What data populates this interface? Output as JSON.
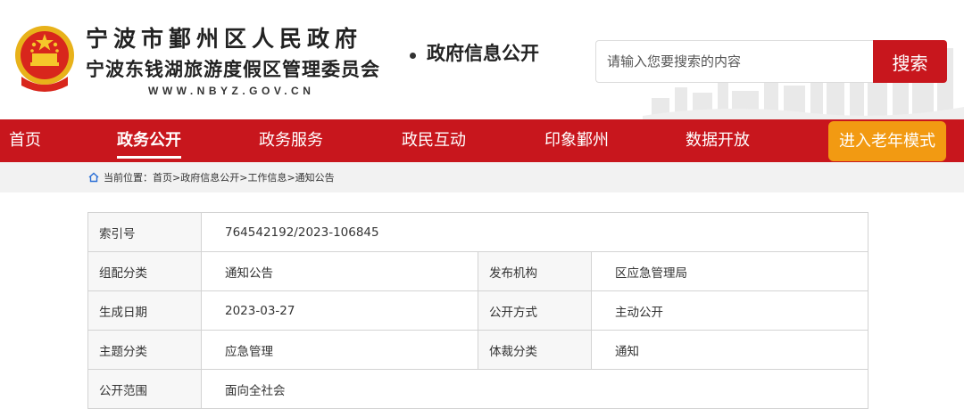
{
  "header": {
    "title_line1": "宁波市鄞州区人民政府",
    "title_line2": "宁波东钱湖旅游度假区管理委员会",
    "url": "WWW.NBYZ.GOV.CN",
    "section": "政府信息公开",
    "emblem_icon": "national-emblem-icon"
  },
  "search": {
    "placeholder": "请输入您要搜索的内容",
    "button_label": "搜索"
  },
  "nav": {
    "items": [
      {
        "label": "首页"
      },
      {
        "label": "政务公开"
      },
      {
        "label": "政务服务"
      },
      {
        "label": "政民互动"
      },
      {
        "label": "印象鄞州"
      },
      {
        "label": "数据开放"
      }
    ],
    "active_index": 1,
    "elder_mode_label": "进入老年模式"
  },
  "breadcrumb": {
    "prefix": "当前位置：",
    "items": [
      "首页",
      "政府信息公开",
      "工作信息",
      "通知公告"
    ],
    "separator": ">",
    "icon": "home-icon"
  },
  "info": {
    "index_no_label": "索引号",
    "index_no": "764542192/2023-106845",
    "category_label": "组配分类",
    "category": "通知公告",
    "publisher_label": "发布机构",
    "publisher": "区应急管理局",
    "date_label": "生成日期",
    "date": "2023-03-27",
    "disclosure_label": "公开方式",
    "disclosure": "主动公开",
    "topic_label": "主题分类",
    "topic": "应急管理",
    "genre_label": "体裁分类",
    "genre": "通知",
    "scope_label": "公开范围",
    "scope": "面向全社会"
  },
  "colors": {
    "brand_red": "#c8161d",
    "elder_orange": "#f29a12",
    "crumb_bg": "#f2f2f2"
  }
}
